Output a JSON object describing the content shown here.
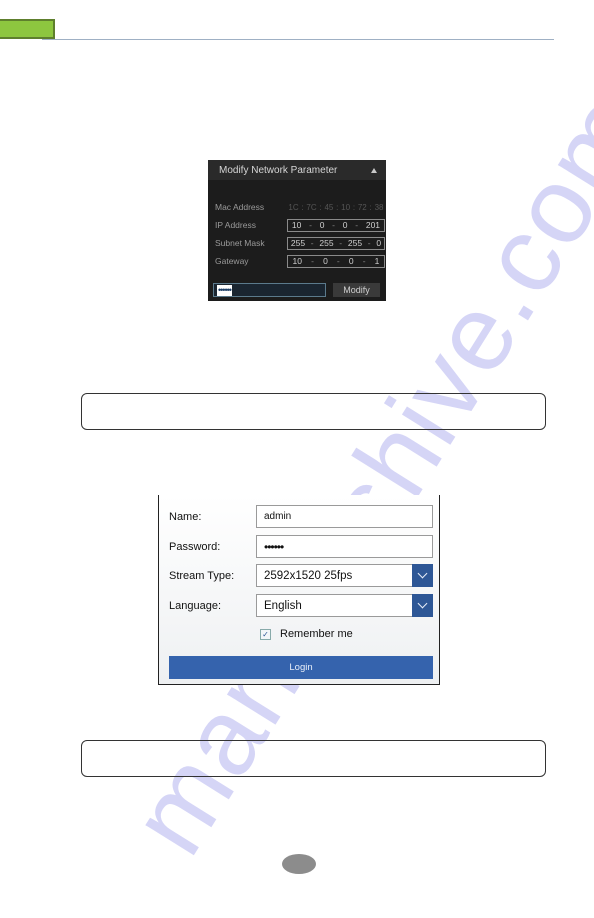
{
  "header": {
    "accent_color": "#8dc63f",
    "rule_color": "#9fb0c4"
  },
  "watermark": {
    "text": "manualshive.com"
  },
  "network_panel": {
    "title": "Modify Network Parameter",
    "collapse_icon": "triangle-up-icon",
    "mac_address": {
      "label": "Mac Address",
      "octets": [
        "1C",
        "7C",
        "45",
        "10",
        "72",
        "38"
      ]
    },
    "ip_address": {
      "label": "IP Address",
      "octets": [
        "10",
        "0",
        "0",
        "201"
      ]
    },
    "subnet_mask": {
      "label": "Subnet Mask",
      "octets": [
        "255",
        "255",
        "255",
        "0"
      ]
    },
    "gateway": {
      "label": "Gateway",
      "octets": [
        "10",
        "0",
        "0",
        "1"
      ]
    },
    "password_value": "••••••",
    "modify_label": "Modify"
  },
  "login_panel": {
    "name_label": "Name:",
    "name_value": "admin",
    "password_label": "Password:",
    "password_value": "••••••",
    "stream_type_label": "Stream Type:",
    "stream_type_value": "2592x1520 25fps",
    "language_label": "Language:",
    "language_value": "English",
    "remember_checked": true,
    "remember_check_glyph": "✓",
    "remember_label": "Remember me",
    "login_label": "Login",
    "accent_color": "#3563ad"
  },
  "notes": [
    {
      "text": ""
    },
    {
      "text": ""
    }
  ],
  "page_number": ""
}
